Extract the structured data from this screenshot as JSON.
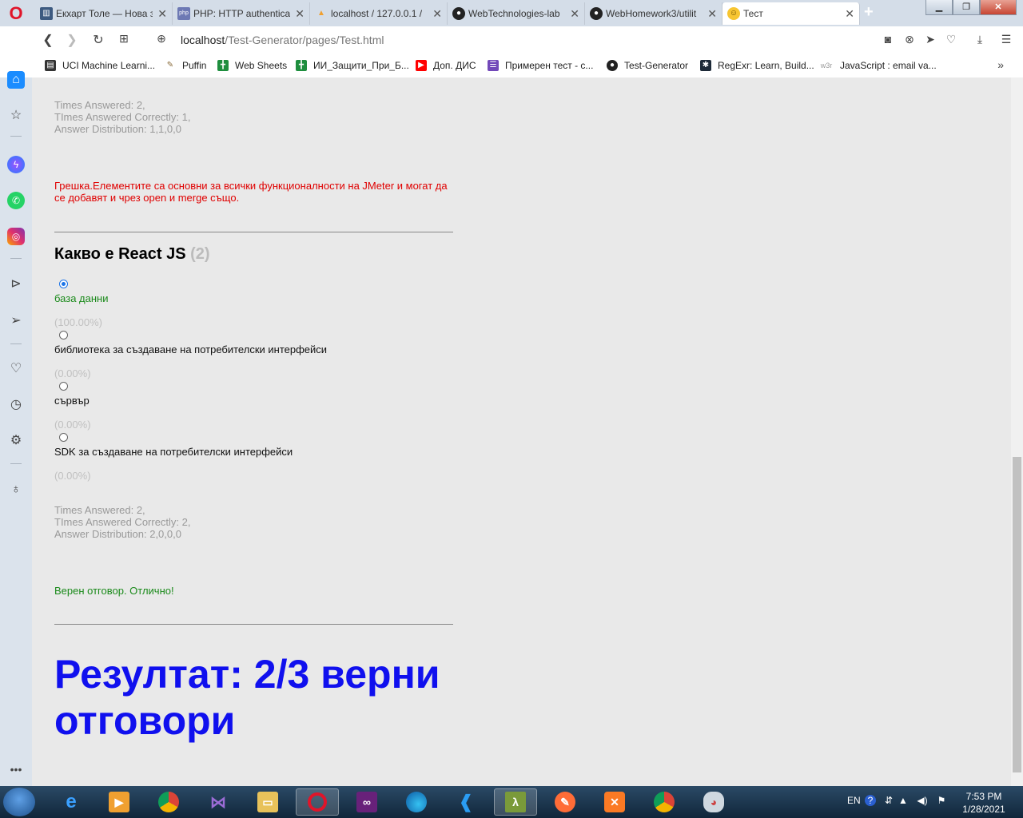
{
  "tabs": [
    {
      "title": "Екхарт Толе — Нова з",
      "favicon_color": "#3d5a80",
      "favicon": "🏛"
    },
    {
      "title": "PHP: HTTP authenticat",
      "favicon_color": "#6d79b4",
      "favicon": "php"
    },
    {
      "title": "localhost / 127.0.0.1 / ",
      "favicon_color": "#f0a030",
      "favicon": "▲"
    },
    {
      "title": "WebTechnologies-lab",
      "favicon_color": "#222222",
      "favicon": "●"
    },
    {
      "title": "WebHomework3/utilit",
      "favicon_color": "#222222",
      "favicon": "●"
    },
    {
      "title": "Тест",
      "favicon_color": "#f7c531",
      "favicon": "☺",
      "active": true
    }
  ],
  "window_controls": {
    "minimize": "▁",
    "maximize": "❐",
    "close": "✕"
  },
  "address": {
    "host": "localhost",
    "path": "/Test-Generator/pages/Test.html"
  },
  "bookmarks": [
    {
      "label": "UCI Machine Learni...",
      "color": "#333333"
    },
    {
      "label": "Puffin",
      "color": "#8a6b3a"
    },
    {
      "label": "Web Sheets",
      "color": "#1e8e3e"
    },
    {
      "label": "ИИ_Защити_При_Б...",
      "color": "#1e8e3e"
    },
    {
      "label": "Доп. ДИС",
      "color": "#ff0000"
    },
    {
      "label": "Примерен тест - с...",
      "color": "#7248b9"
    },
    {
      "label": "Test-Generator",
      "color": "#222222"
    },
    {
      "label": "RegExr: Learn, Build...",
      "color": "#1e2a38"
    },
    {
      "label": "JavaScript : email va...",
      "color": "#999999"
    }
  ],
  "bookmarks_icons": {
    "w3r": "w3r"
  },
  "question1": {
    "stats": {
      "answered": "Times Answered: 2,",
      "correct": "TImes Answered Correctly: 1,",
      "distribution": "Answer Distribution: 1,1,0,0"
    },
    "feedback": "Грешка.Елементите са основни за всички функционалности на JMeter и могат да се добавят и чрез open и merge също."
  },
  "question2": {
    "title": "Какво е React JS",
    "points": "(2)",
    "options": [
      {
        "text": "база данни",
        "percent": "(100.00%)",
        "checked": true,
        "correct": true
      },
      {
        "text": "библиотека за създаване на потребителски интерфейси",
        "percent": "(0.00%)",
        "checked": false
      },
      {
        "text": "сървър",
        "percent": "(0.00%)",
        "checked": false
      },
      {
        "text": "SDK за създаване на потребителски интерфейси",
        "percent": "(0.00%)",
        "checked": false
      }
    ],
    "stats": {
      "answered": "Times Answered: 2,",
      "correct": "TImes Answered Correctly: 2,",
      "distribution": "Answer Distribution: 2,0,0,0"
    },
    "feedback": "Верен отговор. Отлично!"
  },
  "result": "Резултат: 2/3 верни отговори",
  "tray": {
    "language": "EN",
    "time": "7:53 PM",
    "date": "1/28/2021"
  }
}
